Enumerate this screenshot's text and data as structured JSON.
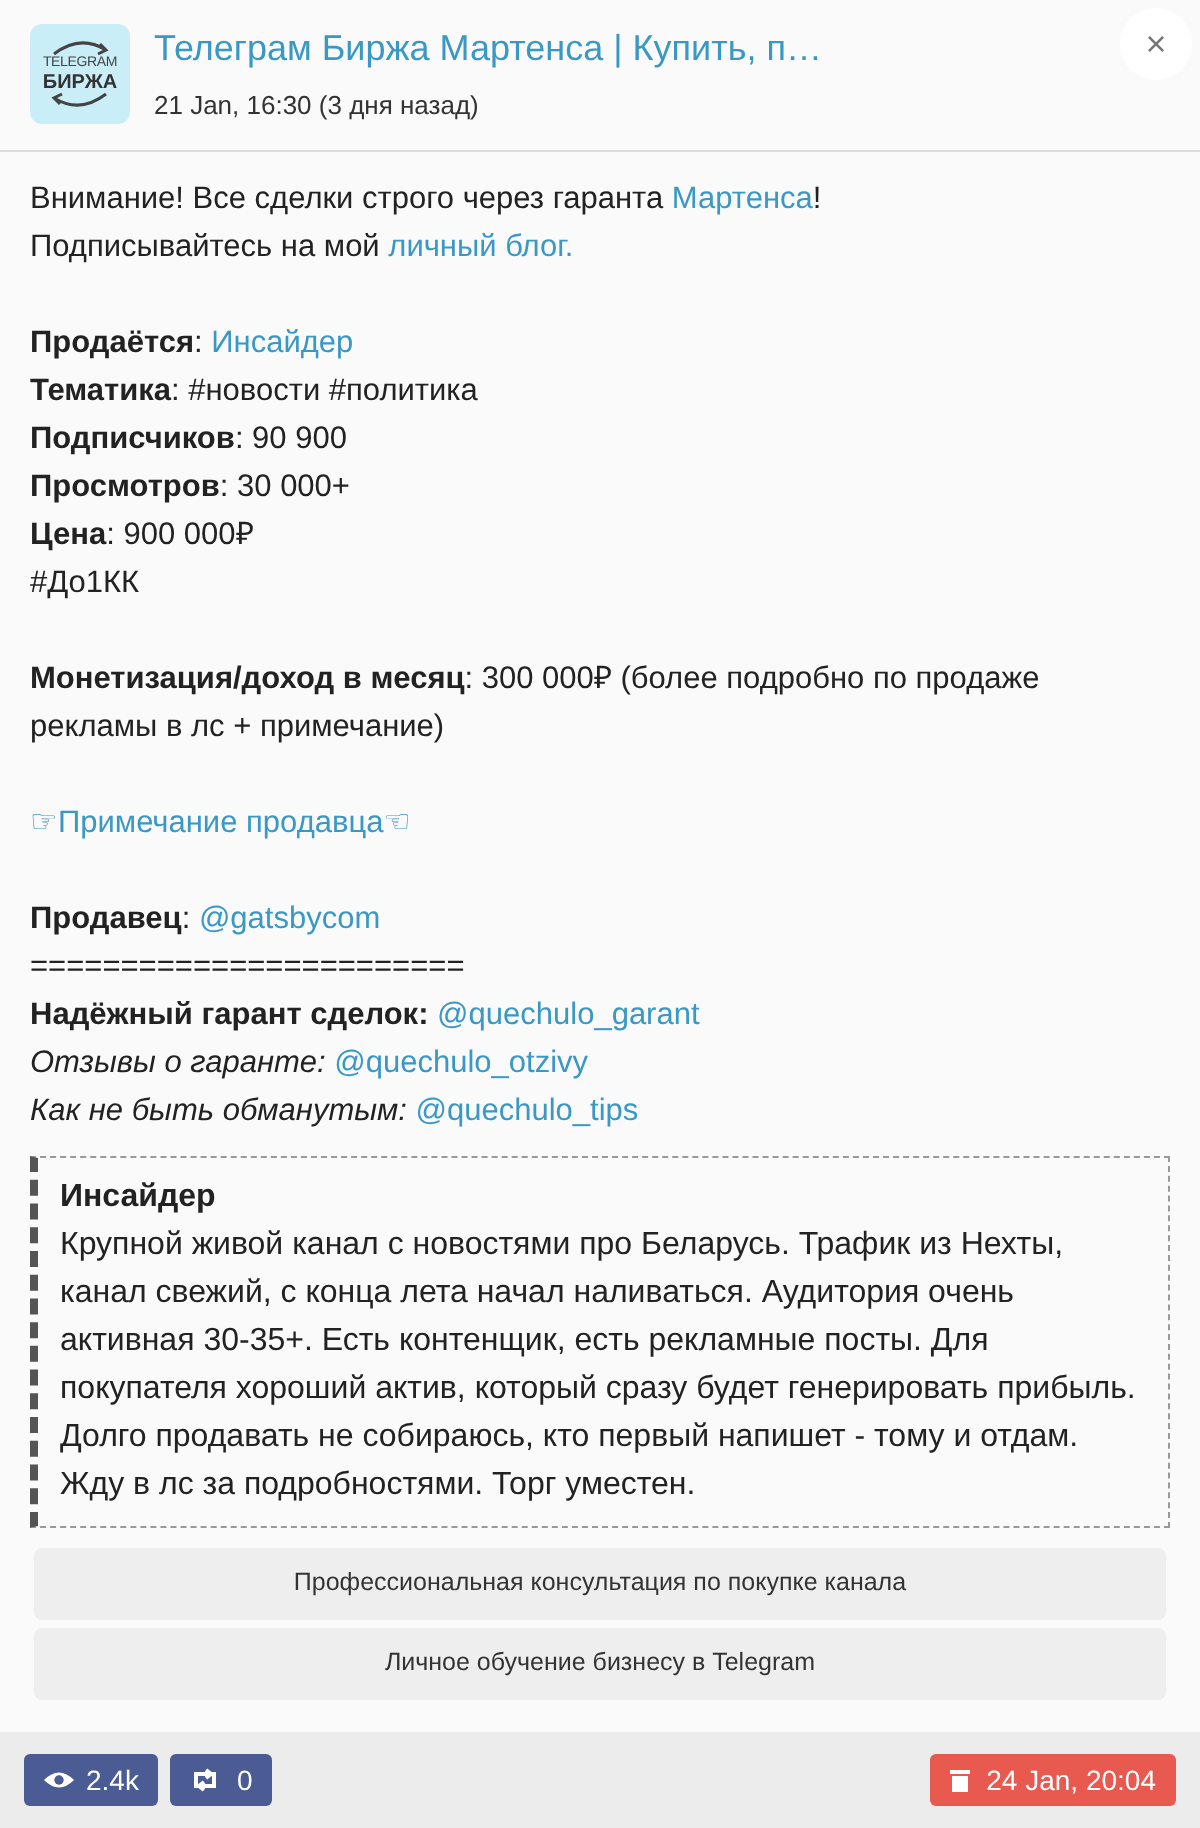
{
  "header": {
    "logo": {
      "line_1": "TELEGRAM",
      "line_2": "БИРЖА"
    },
    "title": "Телеграм Биржа Мартенса | Купить, п…",
    "time": "21 Jan, 16:30 (3 дня назад)",
    "close": "×"
  },
  "paragraphs": [
    [
      [
        {
          "kind": "text",
          "text": "Внимание! Все сделки строго через гаранта "
        },
        {
          "kind": "link",
          "text": "Мартенса"
        },
        {
          "kind": "text",
          "text": "!"
        }
      ],
      [
        {
          "kind": "text",
          "text": "Подписывайтесь на мой "
        },
        {
          "kind": "link",
          "text": "личный блог."
        }
      ]
    ],
    [
      [
        {
          "kind": "bold",
          "text": "Продаётся"
        },
        {
          "kind": "text",
          "text": ": "
        },
        {
          "kind": "link",
          "text": "Инсайдер"
        }
      ],
      [
        {
          "kind": "bold",
          "text": "Тематика"
        },
        {
          "kind": "text",
          "text": ": #новости #политика"
        }
      ],
      [
        {
          "kind": "bold",
          "text": "Подписчиков"
        },
        {
          "kind": "text",
          "text": ": 90 900"
        }
      ],
      [
        {
          "kind": "bold",
          "text": "Просмотров"
        },
        {
          "kind": "text",
          "text": ": 30 000+"
        }
      ],
      [
        {
          "kind": "bold",
          "text": "Цена"
        },
        {
          "kind": "text",
          "text": ": 900 000₽"
        }
      ],
      [
        {
          "kind": "text",
          "text": "#До1КК"
        }
      ]
    ],
    [
      [
        {
          "kind": "bold",
          "text": "Монетизация/доход в месяц"
        },
        {
          "kind": "text",
          "text": ": 300 000₽ (более подробно по продаже рекламы в лс + примечание)"
        }
      ]
    ],
    [
      [
        {
          "kind": "link",
          "text": "☞Примечание продавца☜"
        }
      ]
    ],
    [
      [
        {
          "kind": "bold",
          "text": "Продавец"
        },
        {
          "kind": "text",
          "text": ": "
        },
        {
          "kind": "link",
          "text": "@gatsbycom"
        }
      ],
      [
        {
          "kind": "text",
          "text": "========================"
        }
      ],
      [
        {
          "kind": "bold",
          "text": "Надёжный гарант сделок: "
        },
        {
          "kind": "link",
          "text": "@quechulo_garant"
        }
      ],
      [
        {
          "kind": "italic",
          "text": "Отзывы о гаранте: "
        },
        {
          "kind": "link",
          "text": "@quechulo_otzivy"
        }
      ],
      [
        {
          "kind": "italic",
          "text": "Как не быть обманутым: "
        },
        {
          "kind": "link",
          "text": "@quechulo_tips"
        }
      ]
    ]
  ],
  "quote": {
    "title": "Инсайдер",
    "text": "Крупной живой канал с новостями про Беларусь. Трафик из Нехты, канал свежий, с конца лета начал наливаться. Аудитория очень активная 30-35+. Есть контенщик, есть рекламные посты. Для покупателя хороший актив, который сразу будет генерировать прибыль. Долго продавать не собираюсь, кто первый напишет - тому и отдам. Жду в лс за подробностями. Торг уместен."
  },
  "buttons": [
    "Профессиональная консультация по покупке канала",
    "Личное обучение бизнесу в Telegram"
  ],
  "footer": {
    "views": "2.4k",
    "reposts": "0",
    "date": "24 Jan, 20:04"
  }
}
